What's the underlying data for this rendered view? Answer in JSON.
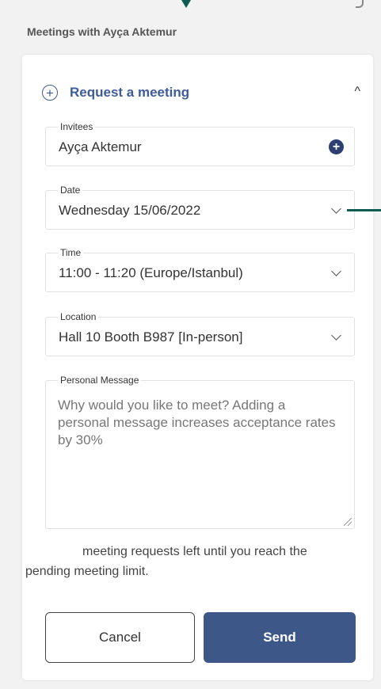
{
  "page": {
    "heading": "Meetings with Ayça Aktemur"
  },
  "request_panel": {
    "title": "Request a meeting",
    "toggle_glyph": "^",
    "add_glyph": "+"
  },
  "form": {
    "invitees": {
      "label": "Invitees",
      "value": "Ayça Aktemur"
    },
    "date": {
      "label": "Date",
      "value": "Wednesday 15/06/2022"
    },
    "time": {
      "label": "Time",
      "value": "11:00 - 11:20 (Europe/Istanbul)"
    },
    "location": {
      "label": "Location",
      "value": "Hall 10 Booth B987 [In-person]"
    },
    "message": {
      "label": "Personal Message",
      "placeholder": "Why would you like to meet? Adding a personal message increases acceptance rates by 30%"
    }
  },
  "limit_notice": {
    "text_part1": "meeting requests left until you reach the",
    "text_part2": "pending meeting limit."
  },
  "buttons": {
    "cancel": "Cancel",
    "send": "Send"
  },
  "icons": {
    "add_invitee": "plus-circle-filled-icon",
    "request": "plus-circle-outline-icon",
    "collapse": "chevron-up-icon",
    "dropdown": "chevron-down-icon"
  },
  "colors": {
    "accent": "#3f5c9a",
    "send_button": "#3d5789",
    "marker": "#0d5c4f"
  }
}
